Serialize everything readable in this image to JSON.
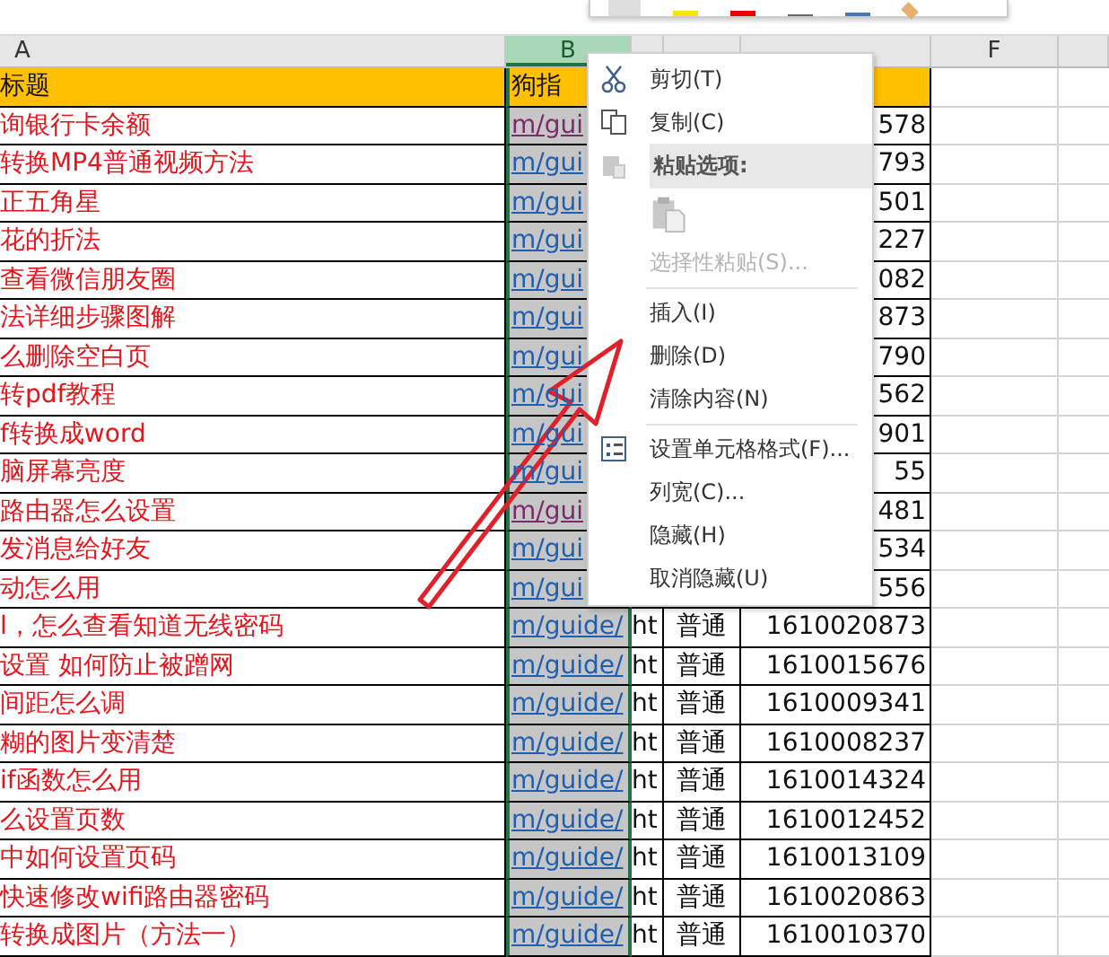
{
  "columns": [
    {
      "label": "A",
      "selected": false
    },
    {
      "label": "B",
      "selected": true
    },
    {
      "selected": false
    },
    {
      "selected": false
    },
    {
      "selected": false
    },
    {
      "label": "F",
      "selected": false
    },
    {
      "selected": false
    }
  ],
  "header_row": {
    "title": "标题",
    "column_2": "狗指"
  },
  "rows": [
    {
      "title": "询银行卡余额",
      "link": "m/gui",
      "visited": true,
      "column_5": "578"
    },
    {
      "title": "转换MP4普通视频方法",
      "link": "m/gui",
      "visited": false,
      "column_5": "793"
    },
    {
      "title": "正五角星",
      "link": "m/gui",
      "visited": false,
      "column_5": "501"
    },
    {
      "title": "花的折法",
      "link": "m/gui",
      "visited": false,
      "column_5": "227"
    },
    {
      "title": "查看微信朋友圈",
      "link": "m/gui",
      "visited": false,
      "column_5": "082"
    },
    {
      "title": "法详细步骤图解",
      "link": "m/gui",
      "visited": false,
      "column_5": "873"
    },
    {
      "title": "么删除空白页",
      "link": "m/gui",
      "visited": false,
      "column_5": "790"
    },
    {
      "title": "转pdf教程",
      "link": "m/gui",
      "visited": false,
      "column_5": "562"
    },
    {
      "title": "f转换成word",
      "link": "m/gui",
      "visited": false,
      "column_5": "901"
    },
    {
      "title": "脑屏幕亮度",
      "link": "m/gui",
      "visited": false,
      "column_5": "55"
    },
    {
      "title": "路由器怎么设置",
      "link": "m/gui",
      "visited": true,
      "column_5": "481"
    },
    {
      "title": "发消息给好友",
      "link": "m/gui",
      "visited": false,
      "column_5": "534"
    },
    {
      "title": "动怎么用",
      "link": "m/gui",
      "visited": false,
      "column_5": "556"
    },
    {
      "title": "l，怎么查看知道无线密码",
      "link": "m/guide/",
      "visited": false,
      "column_3": "ht",
      "column_4": "普通",
      "column_5": "1610020873"
    },
    {
      "title": "设置 如何防止被蹭网",
      "link": "m/guide/",
      "visited": false,
      "column_3": "ht",
      "column_4": "普通",
      "column_5": "1610015676"
    },
    {
      "title": "间距怎么调",
      "link": "m/guide/",
      "visited": false,
      "column_3": "ht",
      "column_4": "普通",
      "column_5": "1610009341"
    },
    {
      "title": "糊的图片变清楚",
      "link": "m/guide/",
      "visited": false,
      "column_3": "ht",
      "column_4": "普通",
      "column_5": "1610008237"
    },
    {
      "title": "if函数怎么用",
      "link": "m/guide/",
      "visited": false,
      "column_3": "ht",
      "column_4": "普通",
      "column_5": "1610014324"
    },
    {
      "title": "么设置页数",
      "link": "m/guide/",
      "visited": false,
      "column_3": "ht",
      "column_4": "普通",
      "column_5": "1610012452"
    },
    {
      "title": "中如何设置页码",
      "link": "m/guide/",
      "visited": false,
      "column_3": "ht",
      "column_4": "普通",
      "column_5": "1610013109"
    },
    {
      "title": "快速修改wifi路由器密码",
      "link": "m/guide/",
      "visited": false,
      "column_3": "ht",
      "column_4": "普通",
      "column_5": "1610020863"
    },
    {
      "title": "转换成图片（方法一）",
      "link": "m/guide/",
      "visited": false,
      "column_3": "ht",
      "column_4": "普通",
      "column_5": "1610010370"
    }
  ],
  "context_menu": {
    "items": [
      {
        "kind": "cut",
        "label": "剪切(T)"
      },
      {
        "kind": "copy",
        "label": "复制(C)"
      },
      {
        "kind": "paste-header",
        "label": "粘贴选项:"
      },
      {
        "kind": "paste-button"
      },
      {
        "kind": "disabled",
        "label": "选择性粘贴(S)..."
      },
      {
        "kind": "plain",
        "label": "插入(I)",
        "separator_before": true
      },
      {
        "kind": "plain",
        "label": "删除(D)"
      },
      {
        "kind": "plain",
        "label": "清除内容(N)"
      },
      {
        "kind": "format",
        "label": "设置单元格格式(F)...",
        "separator_before": true
      },
      {
        "kind": "plain",
        "label": "列宽(C)..."
      },
      {
        "kind": "plain",
        "label": "隐藏(H)"
      },
      {
        "kind": "plain",
        "label": "取消隐藏(U)"
      }
    ]
  }
}
